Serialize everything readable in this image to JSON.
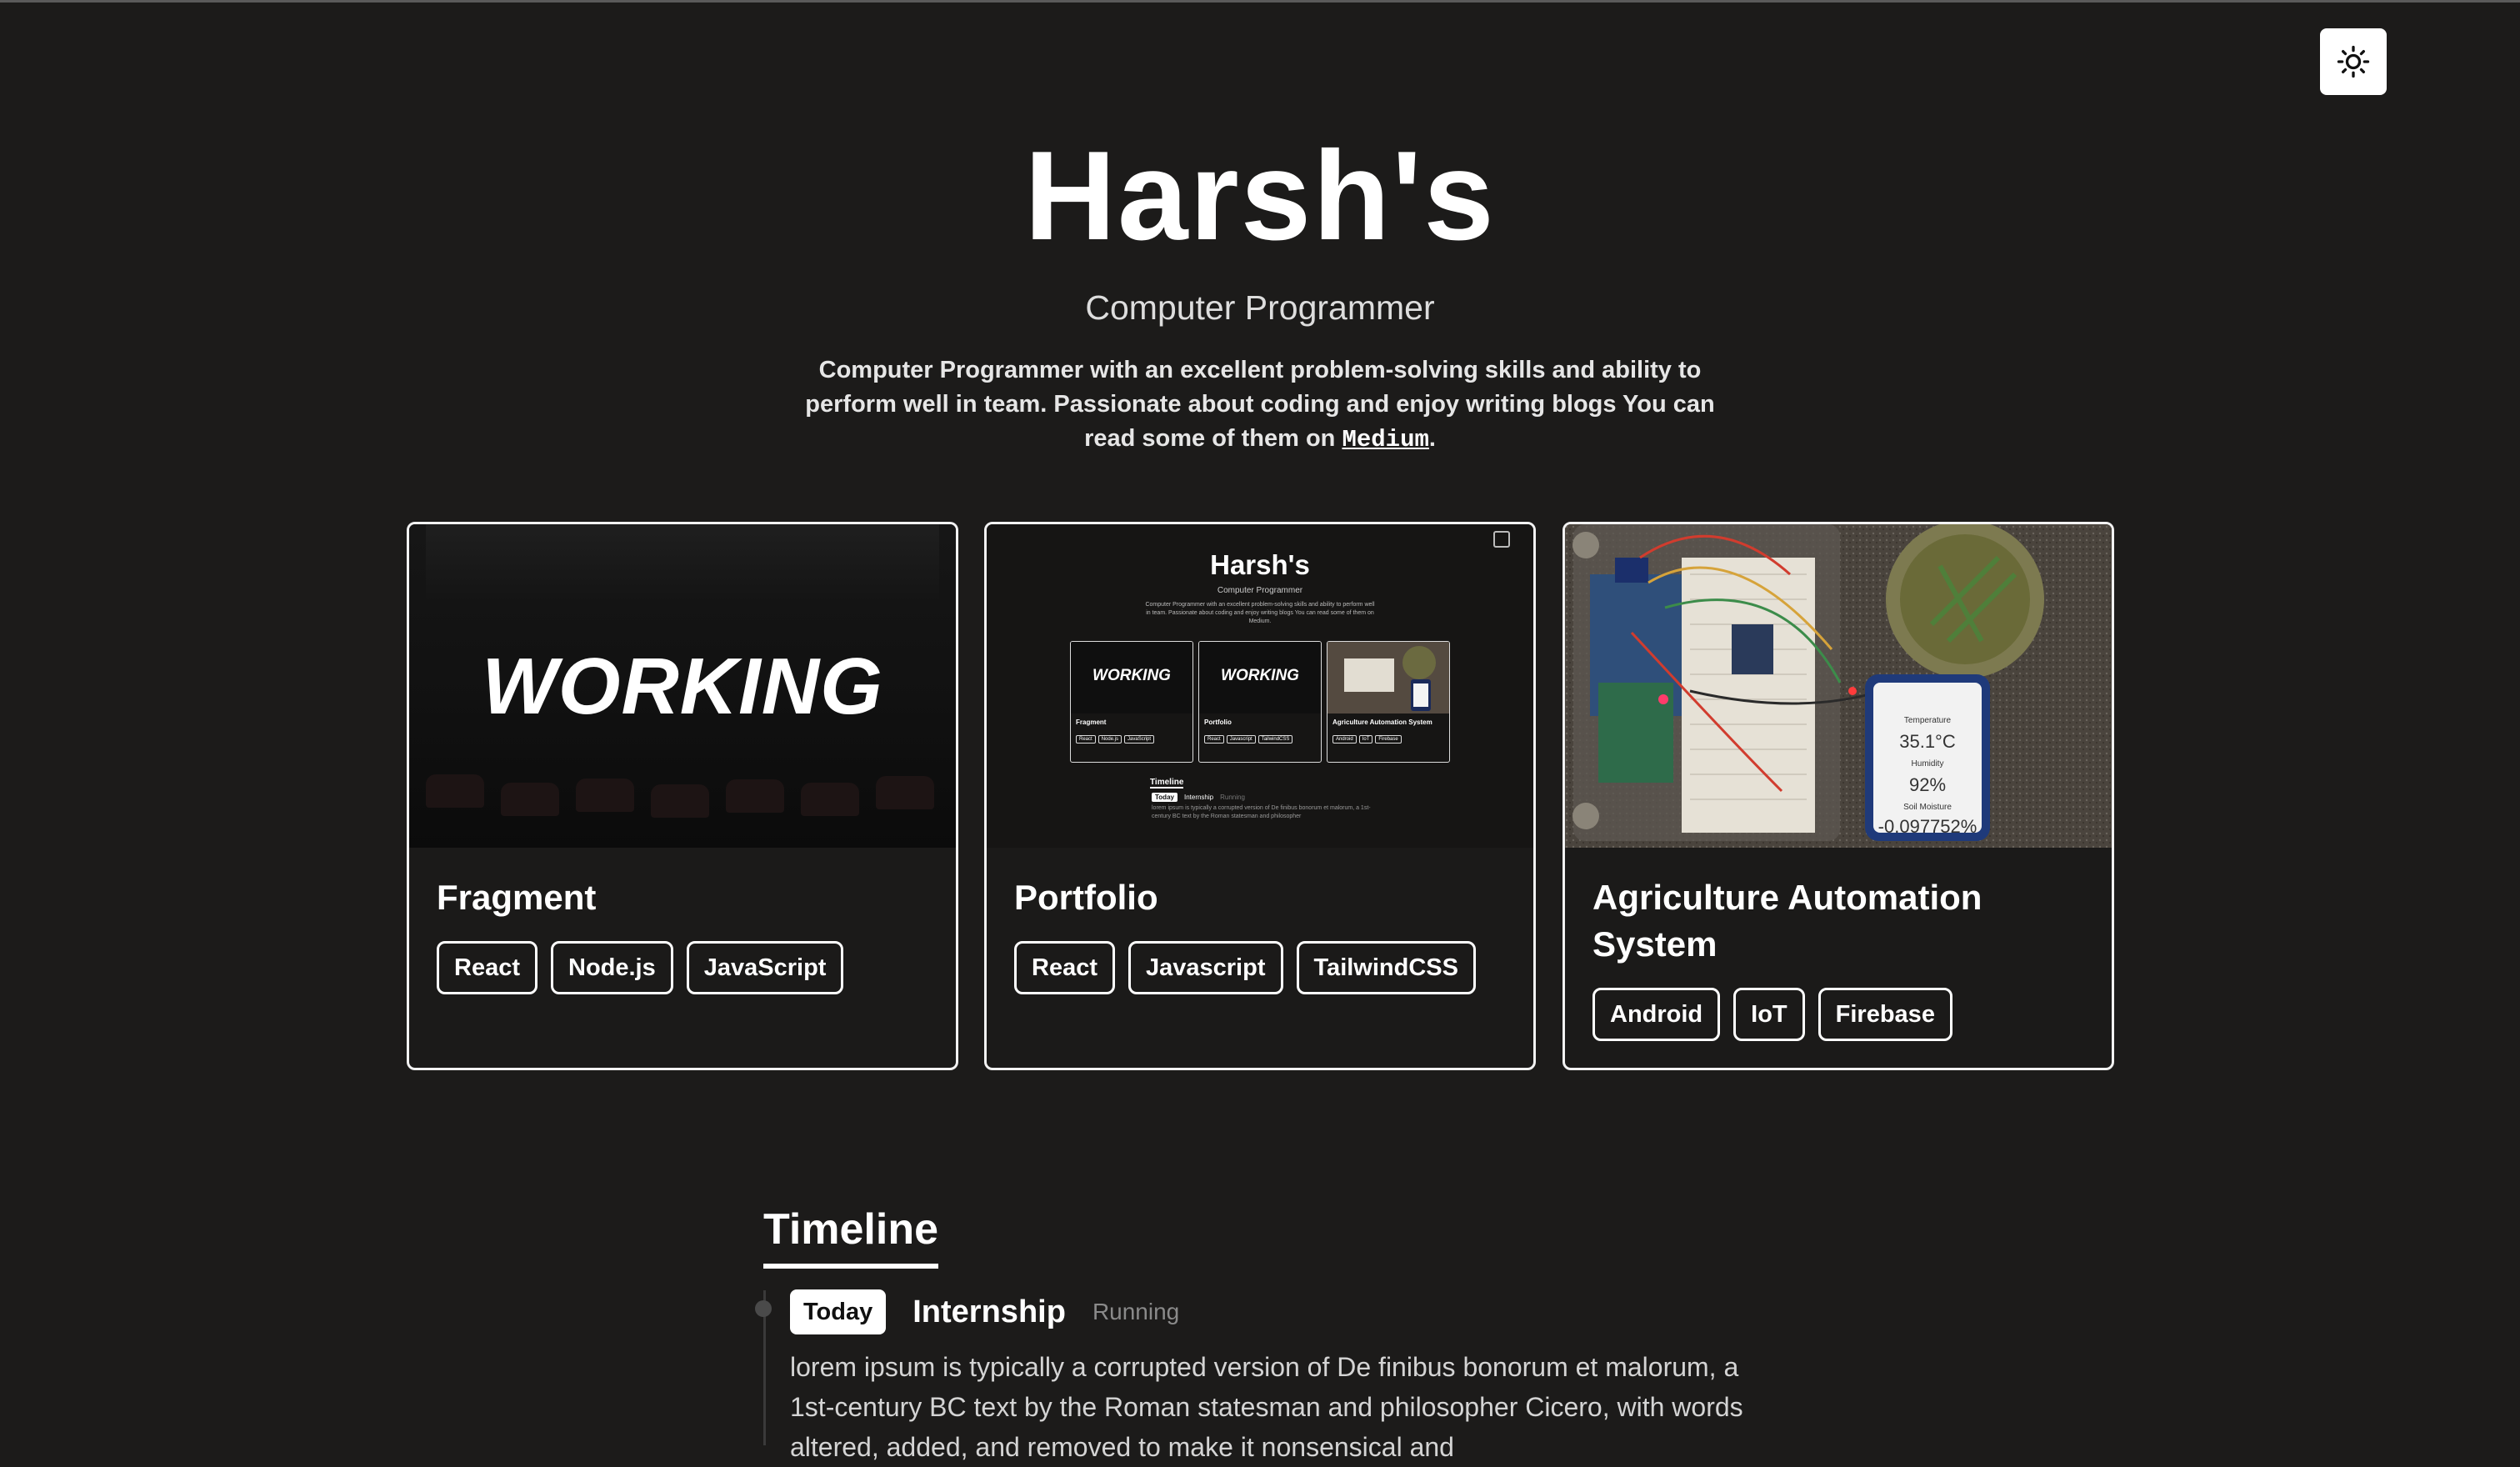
{
  "header": {
    "theme_toggle_icon": "sun-icon"
  },
  "hero": {
    "title": "Harsh's",
    "subtitle": "Computer Programmer",
    "bio_before": "Computer Programmer with an excellent problem-solving skills and ability to perform well in team. Passionate about coding and enjoy writing blogs You can read some of them on ",
    "bio_link": "Medium",
    "bio_after": "."
  },
  "projects": [
    {
      "title": "Fragment",
      "thumb_text": "WORKING",
      "tags": [
        "React",
        "Node.js",
        "JavaScript"
      ]
    },
    {
      "title": "Portfolio",
      "tags": [
        "React",
        "Javascript",
        "TailwindCSS"
      ],
      "preview": {
        "title": "Harsh's",
        "subtitle": "Computer Programmer",
        "bio": "Computer Programmer with an excellent problem-solving skills and ability to perform well in team. Passionate about coding and enjoy writing blogs You can read some of them on Medium.",
        "cards": [
          {
            "word": "WORKING",
            "title": "Fragment",
            "tags": [
              "React",
              "Node.js",
              "JavaScript"
            ]
          },
          {
            "word": "WORKING",
            "title": "Portfolio",
            "tags": [
              "React",
              "Javascript",
              "TailwindCSS"
            ]
          },
          {
            "word": "",
            "title": "Agriculture Automation System",
            "tags": [
              "Android",
              "IoT",
              "Firebase"
            ]
          }
        ],
        "timeline_heading": "Timeline",
        "timeline_badge": "Today",
        "timeline_title": "Internship",
        "timeline_status": "Running",
        "timeline_text": "lorem ipsum is typically a corrupted version of De finibus bonorum et malorum, a 1st-century BC text by the Roman statesman and philosopher"
      }
    },
    {
      "title": "Agriculture Automation System",
      "tags": [
        "Android",
        "IoT",
        "Firebase"
      ],
      "phone_readout": {
        "temp_label": "Temperature",
        "temp": "35.1°C",
        "humidity_label": "Humidity",
        "humidity": "92%",
        "soil_label": "Soil Moisture",
        "soil": "-0.097752%"
      }
    }
  ],
  "timeline": {
    "heading": "Timeline",
    "items": [
      {
        "badge": "Today",
        "title": "Internship",
        "status": "Running",
        "text": "lorem ipsum is typically a corrupted version of De finibus bonorum et malorum, a 1st-century BC text by the Roman statesman and philosopher Cicero, with words altered, added, and removed to make it nonsensical and"
      }
    ]
  }
}
